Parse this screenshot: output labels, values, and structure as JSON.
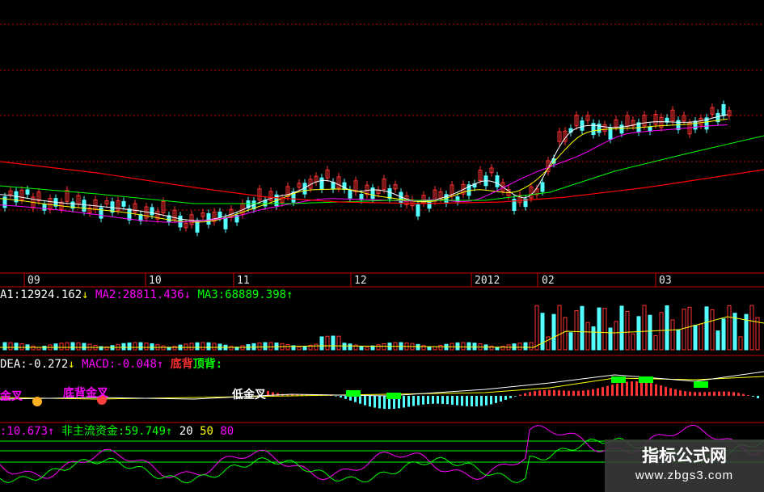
{
  "dates": [
    "09",
    "10",
    "11",
    "12",
    "2012",
    "02",
    "03"
  ],
  "volume_line": {
    "a1": "A1:12924.162",
    "a1_arrow": "↓",
    "a2": "MA2:28811.436",
    "a2_arrow": "↓",
    "a3": "MA3:68889.398",
    "a3_arrow": "↑"
  },
  "macd_line": {
    "dea": "DEA:-0.272",
    "dea_arrow": "↓",
    "macd": "MACD:-0.048",
    "macd_arrow": "↑",
    "bottom_div": "底背",
    "top_div": "顶背:"
  },
  "macd_signals": {
    "s1": "金叉",
    "s2": "底背金叉",
    "s3": "低金叉"
  },
  "fund_line": {
    "v1": ":10.673",
    "v1_arrow": "↑",
    "label": "非主流资金:59.749",
    "label_arrow": "↑",
    "levels": [
      "20",
      "50",
      "80"
    ]
  },
  "watermark": {
    "title": "指标公式网",
    "url": "www.zbgs3.com"
  },
  "colors": {
    "up": "#ff3232",
    "down": "#54ffff",
    "ma5": "#ffffff",
    "ma10": "#ffff00",
    "ma20": "#ff00ff",
    "ma30": "#00ff00",
    "ma60": "#ff0000",
    "grid": "#cc0000",
    "fund1": "#ff00ff",
    "fund2": "#00ff00"
  }
}
